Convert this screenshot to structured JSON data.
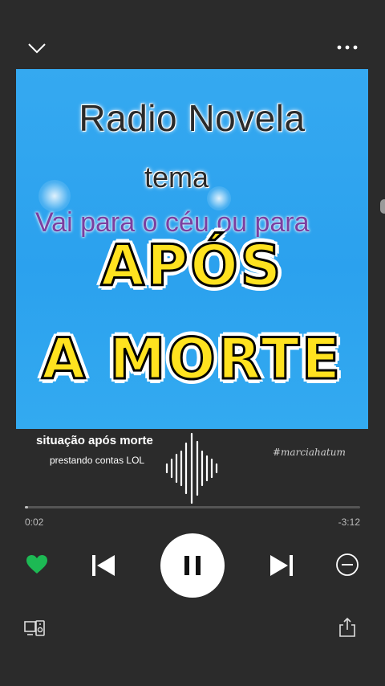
{
  "header": {
    "collapse_icon": "chevron-down-icon",
    "menu_icon": "more-dots-icon"
  },
  "artwork": {
    "title": "Radio Novela",
    "subtitle": "tema",
    "question": "Vai para o céu ou para",
    "big_line1": "APÓS",
    "big_line2": "A MORTE"
  },
  "track": {
    "title": "situação após morte",
    "artist": "prestando contas LOL",
    "watermark": "#marciahatum"
  },
  "playback": {
    "elapsed": "0:02",
    "remaining": "-3:12",
    "progress_fraction": 0.01
  },
  "controls": {
    "like_icon": "heart-icon",
    "prev_icon": "skip-previous-icon",
    "pause_icon": "pause-icon",
    "next_icon": "skip-next-icon",
    "remove_icon": "minus-circle-icon",
    "devices_icon": "connect-devices-icon",
    "share_icon": "share-icon",
    "accent_color": "#1db954"
  }
}
